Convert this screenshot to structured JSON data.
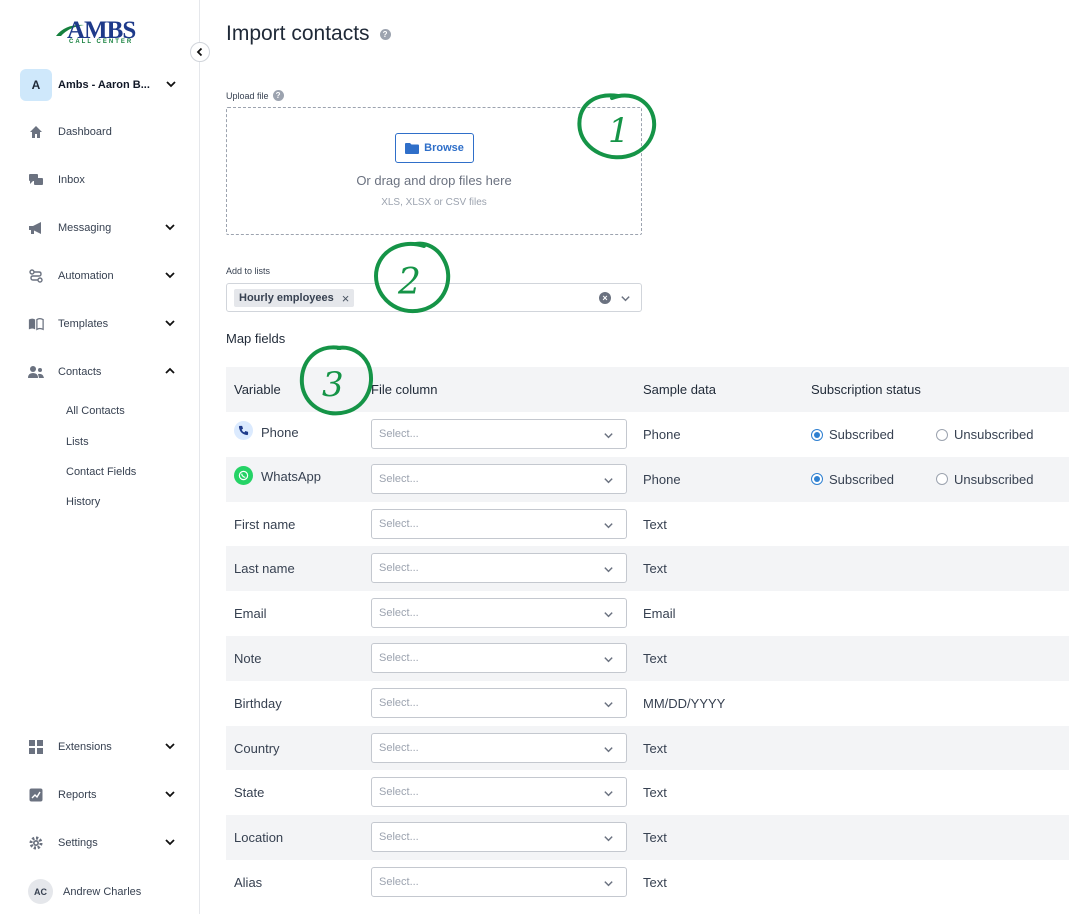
{
  "brand": {
    "logo_main": "AMBS",
    "logo_sub": "CALL CENTER",
    "primary": "#1e3a8a",
    "accent": "#15803d"
  },
  "account": {
    "initial": "A",
    "name": "Ambs - Aaron B..."
  },
  "nav": [
    {
      "label": "Dashboard",
      "icon": "home-icon"
    },
    {
      "label": "Inbox",
      "icon": "chat-icon"
    },
    {
      "label": "Messaging",
      "icon": "megaphone-icon"
    },
    {
      "label": "Automation",
      "icon": "route-icon"
    },
    {
      "label": "Templates",
      "icon": "book-icon"
    },
    {
      "label": "Contacts",
      "icon": "users-icon"
    }
  ],
  "contacts_sub": [
    "All Contacts",
    "Lists",
    "Contact Fields",
    "History"
  ],
  "nav_bottom": [
    {
      "label": "Extensions",
      "icon": "grid-icon"
    },
    {
      "label": "Reports",
      "icon": "chart-icon"
    },
    {
      "label": "Settings",
      "icon": "gear-icon"
    }
  ],
  "user": {
    "initials": "AC",
    "name": "Andrew Charles"
  },
  "page": {
    "title": "Import contacts"
  },
  "upload": {
    "label": "Upload file",
    "browse_label": "Browse",
    "drag_text": "Or drag and drop files here",
    "hint": "XLS, XLSX or CSV files"
  },
  "lists": {
    "label": "Add to lists",
    "chip": "Hourly employees"
  },
  "map": {
    "title": "Map fields",
    "headers": {
      "variable": "Variable",
      "file_column": "File column",
      "sample": "Sample data",
      "subscription": "Subscription status"
    },
    "select_placeholder": "Select...",
    "subscribed": "Subscribed",
    "unsubscribed": "Unsubscribed",
    "rows": [
      {
        "variable": "Phone",
        "sample": "Phone"
      },
      {
        "variable": "WhatsApp",
        "sample": "Phone"
      },
      {
        "variable": "First name",
        "sample": "Text"
      },
      {
        "variable": "Last name",
        "sample": "Text"
      },
      {
        "variable": "Email",
        "sample": "Email"
      },
      {
        "variable": "Note",
        "sample": "Text"
      },
      {
        "variable": "Birthday",
        "sample": "MM/DD/YYYY"
      },
      {
        "variable": "Country",
        "sample": "Text"
      },
      {
        "variable": "State",
        "sample": "Text"
      },
      {
        "variable": "Location",
        "sample": "Text"
      },
      {
        "variable": "Alias",
        "sample": "Text"
      }
    ]
  },
  "annotations": [
    "1",
    "2",
    "3"
  ]
}
